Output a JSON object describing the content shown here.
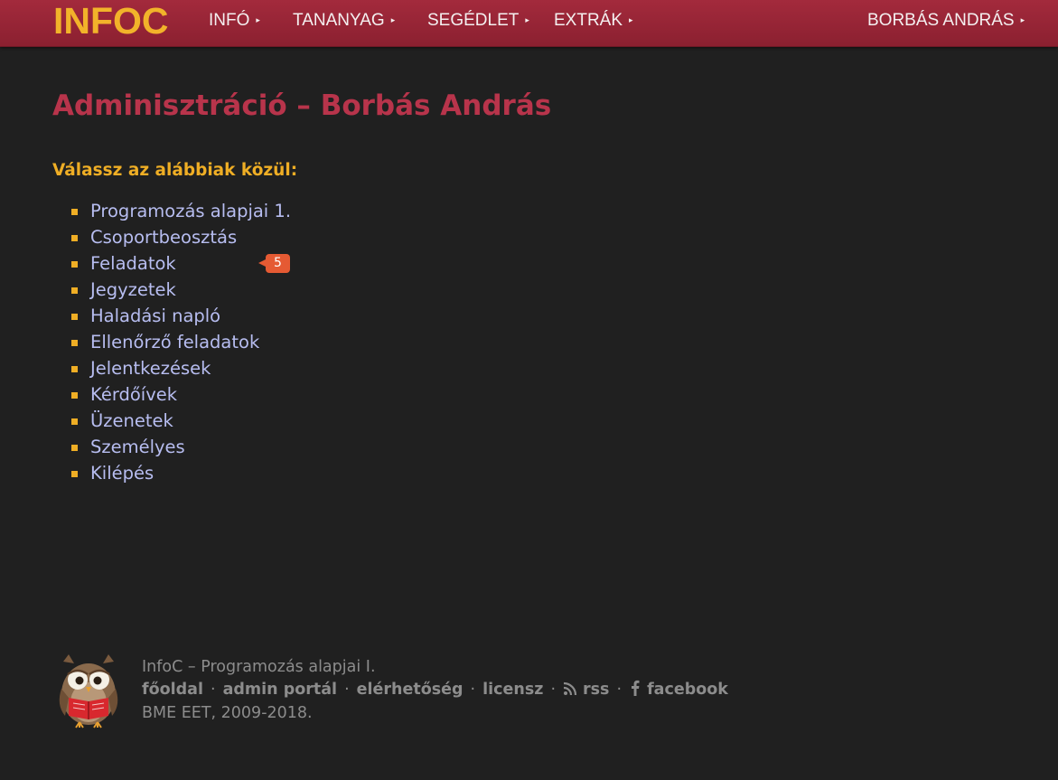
{
  "header": {
    "logo": "INFOC",
    "nav": [
      {
        "label": "INFÓ"
      },
      {
        "label": "TANANYAG"
      },
      {
        "label": "SEGÉDLET"
      },
      {
        "label": "EXTRÁK"
      }
    ],
    "user": "BORBÁS ANDRÁS",
    "arrow": "▸"
  },
  "main": {
    "title": "Adminisztráció – Borbás András",
    "subtitle": "Válassz az alábbiak közül:",
    "items": [
      {
        "label": "Programozás alapjai 1."
      },
      {
        "label": "Csoportbeosztás"
      },
      {
        "label": "Feladatok",
        "badge": "5"
      },
      {
        "label": "Jegyzetek"
      },
      {
        "label": "Haladási napló"
      },
      {
        "label": "Ellenőrző feladatok"
      },
      {
        "label": "Jelentkezések"
      },
      {
        "label": "Kérdőívek"
      },
      {
        "label": "Üzenetek"
      },
      {
        "label": "Személyes"
      },
      {
        "label": "Kilépés"
      }
    ]
  },
  "footer": {
    "line1": "InfoC – Programozás alapjai I.",
    "links": {
      "home": "főoldal",
      "admin": "admin portál",
      "contact": "elérhetőség",
      "license": "licensz",
      "rss": "rss",
      "facebook": "facebook"
    },
    "separator": "·",
    "line3": "BME EET, 2009-2018."
  },
  "colors": {
    "header_bg": "#9b2536",
    "logo": "#f2b32a",
    "title": "#b8344b",
    "subtitle": "#efae25",
    "link": "#b7bdf0",
    "badge": "#e55a33",
    "background": "#202020"
  }
}
